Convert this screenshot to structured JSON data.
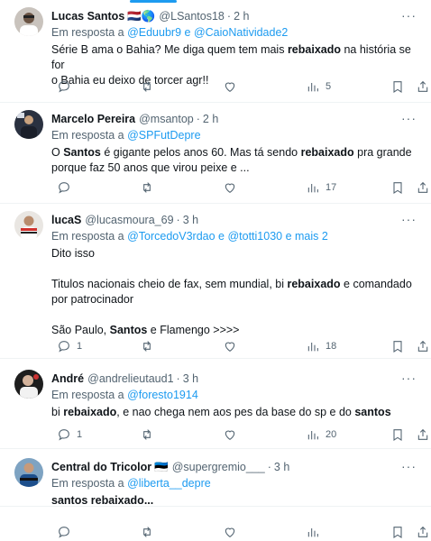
{
  "tweets": [
    {
      "name": "Lucas Santos",
      "flag": "🇳🇱🌎",
      "handle": "@LSantos18",
      "dot": "·",
      "time": "2 h",
      "reply_prefix": "Em resposta a ",
      "reply_to": [
        "@Eduubr9",
        "@CaioNatividade2"
      ],
      "reply_joiner": " e ",
      "lines": [
        [
          {
            "t": "Série B ama o Bahia? Me diga quem tem mais "
          },
          {
            "t": "rebaixado",
            "b": true
          },
          {
            "t": " na história se for"
          }
        ],
        [
          {
            "t": "o Bahia eu deixo de torcer agr!!"
          }
        ]
      ],
      "replies": "",
      "retweets": "",
      "likes": "",
      "views": "5"
    },
    {
      "name": "Marcelo Pereira",
      "handle": "@msantop",
      "dot": "·",
      "time": "2 h",
      "reply_prefix": "Em resposta a ",
      "reply_to": [
        "@SPFutDepre"
      ],
      "reply_joiner": " e ",
      "lines": [
        [
          {
            "t": "O "
          },
          {
            "t": "Santos",
            "b": true
          },
          {
            "t": " é gigante pelos anos 60. Mas tá sendo "
          },
          {
            "t": "rebaixado",
            "b": true
          },
          {
            "t": " pra grande"
          }
        ],
        [
          {
            "t": "porque faz 50 anos que virou peixe e ..."
          }
        ]
      ],
      "replies": "",
      "retweets": "",
      "likes": "",
      "views": "17"
    },
    {
      "name": "lucaS",
      "handle": "@lucasmoura_69",
      "dot": "·",
      "time": "3 h",
      "reply_prefix": "Em resposta a ",
      "reply_to": [
        "@TorcedoV3rdao",
        "@totti1030",
        "mais 2"
      ],
      "reply_joiner": " e ",
      "lines": [
        [
          {
            "t": "Dito isso"
          }
        ],
        [
          {
            "t": ""
          }
        ],
        [
          {
            "t": "Titulos nacionais cheio de fax, sem mundial, bi "
          },
          {
            "t": "rebaixado",
            "b": true
          },
          {
            "t": " e comandado"
          }
        ],
        [
          {
            "t": "por patrocinador"
          }
        ],
        [
          {
            "t": ""
          }
        ],
        [
          {
            "t": "São Paulo, "
          },
          {
            "t": "Santos",
            "b": true
          },
          {
            "t": " e Flamengo >>>>"
          }
        ]
      ],
      "replies": "1",
      "retweets": "",
      "likes": "",
      "views": "18"
    },
    {
      "name": "André",
      "handle": "@andrelieutaud1",
      "dot": "·",
      "time": "3 h",
      "reply_prefix": "Em resposta a ",
      "reply_to": [
        "@foresto1914"
      ],
      "reply_joiner": " e ",
      "lines": [
        [
          {
            "t": "bi "
          },
          {
            "t": "rebaixado",
            "b": true
          },
          {
            "t": ", e nao chega nem aos pes da base do sp e do "
          },
          {
            "t": "santos",
            "b": true
          }
        ]
      ],
      "replies": "1",
      "retweets": "",
      "likes": "",
      "views": "20"
    },
    {
      "name": "Central do Tricolor",
      "flag": "🇪🇪",
      "handle": "@supergremio___",
      "dot": "·",
      "time": "3 h",
      "reply_prefix": "Em resposta a ",
      "reply_to": [
        "@liberta__depre"
      ],
      "reply_joiner": " e ",
      "lines": [
        [
          {
            "t": "santos rebaixado...",
            "b": true
          }
        ]
      ],
      "replies": "",
      "retweets": "",
      "likes": "",
      "views": ""
    }
  ],
  "icons": {
    "more": "more-dots-icon",
    "reply": "reply-icon",
    "retweet": "retweet-icon",
    "like": "heart-icon",
    "views": "views-icon",
    "bookmark": "bookmark-icon",
    "share": "share-icon"
  },
  "colors": {
    "link": "#1d9bf0",
    "secondary": "#536471",
    "text": "#0f1419"
  }
}
